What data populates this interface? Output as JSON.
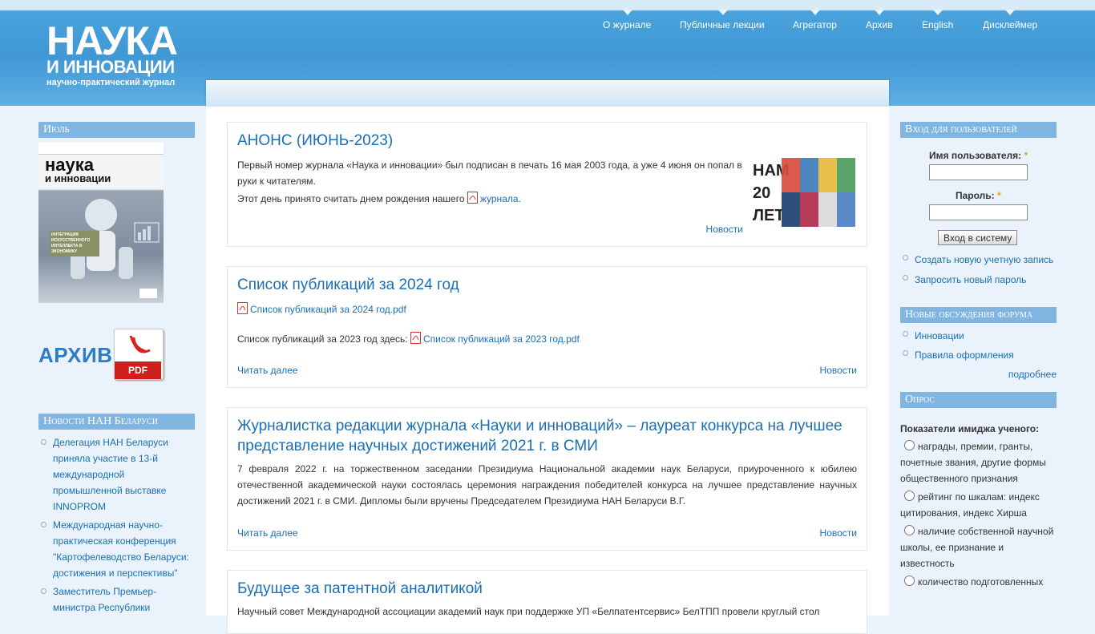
{
  "logo": {
    "line1": "НАУКА",
    "line2": "И ИННОВАЦИИ",
    "line3": "научно-практический журнал"
  },
  "topnav": [
    "О журнале",
    "Публичные лекции",
    "Агрегатор",
    "Архив",
    "English",
    "Дисклеймер"
  ],
  "left": {
    "issue_title": "Июль",
    "cover": {
      "title_line1": "наука",
      "title_line2": "и инновации",
      "caption": "ИНТЕГРАЦИЯ ИСКУССТВЕННОГО ИНТЕЛЛЕКТА В ЭКОНОМИКУ"
    },
    "archive_label": "АРХИВ",
    "archive_pdf": "PDF",
    "news_title": "Новости НАН Беларуси",
    "news": [
      "Делегация НАН Беларуси приняла участие в 13-й международной промышленной выставке INNOPROM",
      "Международная научно-практическая конференция \"Картофелеводство Беларуси: достижения и перспективы\"",
      "Заместитель Премьер-министра Республики"
    ]
  },
  "nodes": [
    {
      "title": "АНОНС (ИЮНЬ-2023)",
      "p1": "Первый номер журнала «Наука и инновации» был подписан в печать 16 мая 2003 года, а уже 4 июня он попал в руки к читателям.",
      "p2_text": "Этот день принято считать днем рождения нашего",
      "p2_link": "журнала.",
      "image_label": "НАМ 20 ЛЕТ!",
      "category": "Новости"
    },
    {
      "title": "Список публикаций за 2024 год",
      "file1": "Список публикаций за 2024 год.pdf",
      "p_text": "Список публикаций за 2023 год здесь:",
      "file2": "Список публикаций за 2023 год.pdf",
      "read_more": "Читать далее",
      "category": "Новости"
    },
    {
      "title": "Журналистка редакции журнала «Науки и инноваций» – лауреат конкурса на лучшее представление научных достижений 2021 г. в СМИ",
      "body": "7 февраля 2022 г. на торжественном заседании Президиума Национальной академии наук Беларуси, приуроченного к юбилею отечественной академической науки состоялась церемония награждения победителей конкурса на лучшее представление научных достижений 2021 г. в СМИ. Дипломы были вручены Председателем Президиума НАН Беларуси В.Г.",
      "read_more": "Читать далее",
      "category": "Новости"
    },
    {
      "title": "Будущее за патентной аналитикой",
      "body": "Научный совет Международной ассоциации академий наук при поддержке УП «Белпатентсервис» БелТПП провели круглый стол"
    }
  ],
  "right": {
    "login_title": "Вход для пользователей",
    "username_label": "Имя пользователя:",
    "password_label": "Пароль:",
    "required_mark": "*",
    "login_button": "Вход в систему",
    "links": [
      "Создать новую учетную запись",
      "Запросить новый пароль"
    ],
    "forum_title": "Новые обсуждения форума",
    "forum": [
      "Инновации",
      "Правила оформления"
    ],
    "more": "подробнее",
    "poll_title": "Опрос",
    "poll_question": "Показатели имиджа ученого:",
    "poll_options": [
      "награды, премии, гранты, почетные звания, другие формы общественного признания",
      "рейтинг по шкалам: индекс цитирования, индекс Хирша",
      "наличие собственной научной школы, ее признание и известность",
      "количество подготовленных"
    ]
  }
}
